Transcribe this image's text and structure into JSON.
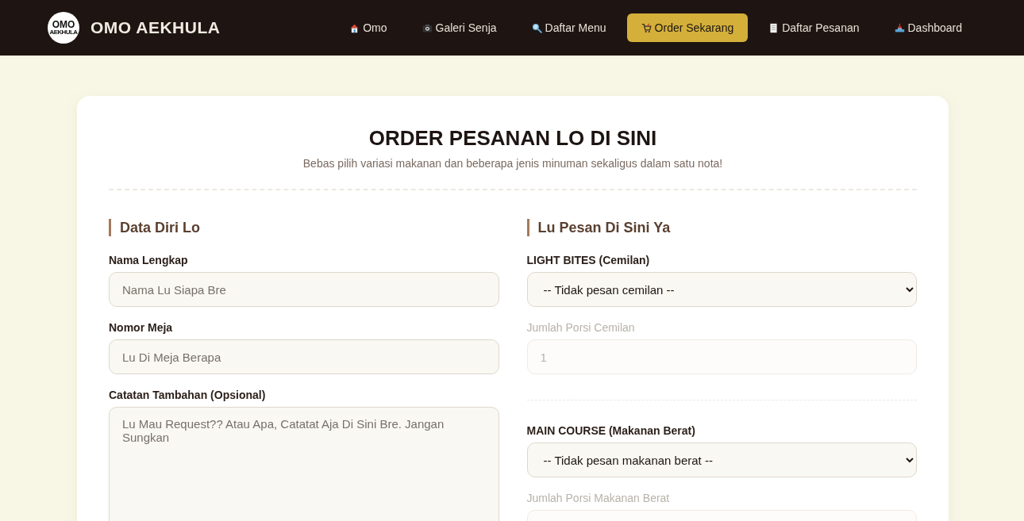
{
  "navbar": {
    "logo": {
      "line_1": "OMO",
      "line_2": "AEKHULA"
    },
    "brand": "OMO AEKHULA",
    "items": [
      {
        "label": "Omo",
        "selected": false
      },
      {
        "label": "Galeri Senja",
        "selected": false
      },
      {
        "label": "Daftar Menu",
        "selected": false
      },
      {
        "label": "Order Sekarang",
        "selected": true
      },
      {
        "label": "Daftar Pesanan",
        "selected": false
      },
      {
        "label": "Dashboard",
        "selected": false
      }
    ]
  },
  "order_card": {
    "title": "ORDER PESANAN LO DI SINI",
    "subtitle": "Bebas pilih variasi makanan dan beberapa jenis minuman sekaligus dalam satu nota!",
    "personal_section": {
      "heading": "Data Diri Lo",
      "fields": [
        {
          "kind": "text",
          "label": "Nama Lengkap",
          "placeholder": "Nama Lu Siapa Bre"
        },
        {
          "kind": "text",
          "label": "Nomor Meja",
          "placeholder": "Lu Di Meja Berapa"
        },
        {
          "kind": "textarea",
          "label": "Catatan Tambahan (Opsional)",
          "placeholder": "Lu Mau Request?? Atau Apa, Catatat Aja Di Sini Bre. Jangan Sungkan"
        }
      ]
    },
    "order_section": {
      "heading": "Lu Pesan Di Sini Ya",
      "groups": [
        {
          "label": "LIGHT BITES (Cemilan)",
          "selected_option": "-- Tidak pesan cemilan --",
          "quantity": {
            "label": "Jumlah Porsi Cemilan",
            "value": "1",
            "disabled": true
          }
        },
        {
          "label": "MAIN COURSE (Makanan Berat)",
          "selected_option": "-- Tidak pesan makanan berat --",
          "quantity": {
            "label": "Jumlah Porsi Makanan Berat",
            "disabled": true
          }
        }
      ]
    }
  }
}
